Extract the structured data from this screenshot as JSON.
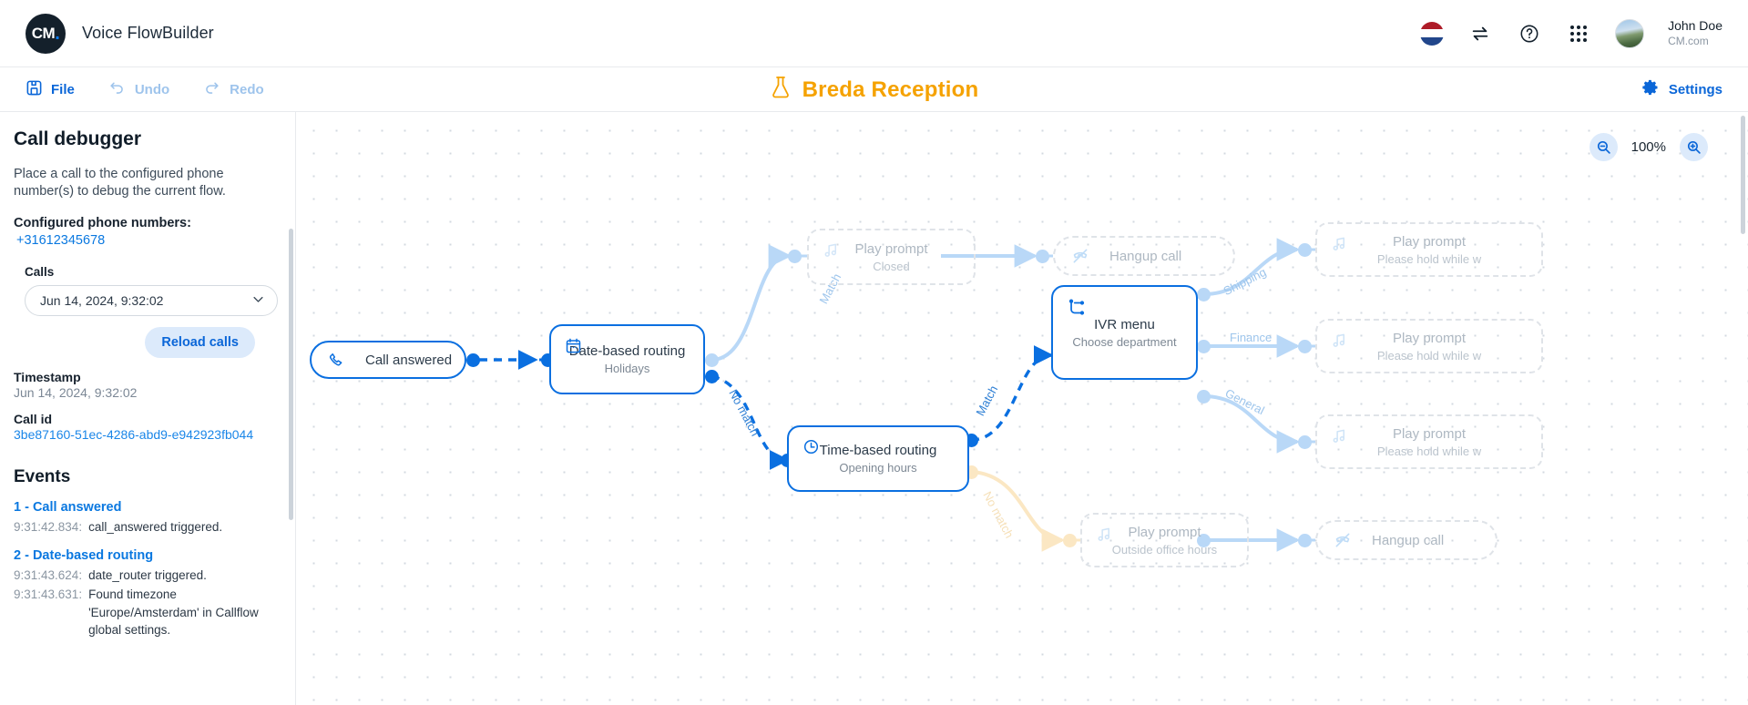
{
  "app": {
    "brand_name": "Voice FlowBuilder",
    "logo_text": "CM",
    "flow_title": "Breda Reception",
    "flow_icon": "flask-icon"
  },
  "topbar": {
    "flag": "netherlands-flag-icon",
    "switch_icon": "switch-arrows-icon",
    "help_icon": "help-circle-icon",
    "apps_icon": "apps-grid-icon",
    "avatar": "user-avatar",
    "user_name": "John Doe",
    "user_org": "CM.com"
  },
  "actionbar": {
    "file": "File",
    "undo": "Undo",
    "redo": "Redo",
    "settings": "Settings"
  },
  "sidebar": {
    "title": "Call debugger",
    "description": "Place a call to the configured phone number(s) to debug the current flow.",
    "configured_label": "Configured phone numbers:",
    "phone_number": "+31612345678",
    "calls_label": "Calls",
    "selected_call": "Jun 14, 2024, 9:32:02",
    "reload_button": "Reload calls",
    "timestamp_label": "Timestamp",
    "timestamp_value": "Jun 14, 2024, 9:32:02",
    "callid_label": "Call id",
    "callid_value": "3be87160-51ec-4286-abd9-e942923fb044",
    "events_heading": "Events",
    "events": [
      {
        "title": "1 - Call answered",
        "lines": [
          {
            "time": "9:31:42.834:",
            "msg": "call_answered triggered."
          }
        ]
      },
      {
        "title": "2 - Date-based routing",
        "lines": [
          {
            "time": "9:31:43.624:",
            "msg": "date_router triggered."
          },
          {
            "time": "9:31:43.631:",
            "msg": "Found timezone 'Europe/Amsterdam' in Callflow global settings."
          }
        ]
      }
    ]
  },
  "canvas": {
    "zoom_level": "100%",
    "zoom_out_icon": "zoom-out-icon",
    "zoom_in_icon": "zoom-in-icon",
    "nodes": [
      {
        "id": "call-answered",
        "title": "Call answered",
        "subtitle": "",
        "icon": "phone-icon",
        "state": "active"
      },
      {
        "id": "date-routing",
        "title": "Date-based routing",
        "subtitle": "Holidays",
        "icon": "calendar-icon",
        "state": "active"
      },
      {
        "id": "prompt-closed",
        "title": "Play prompt",
        "subtitle": "Closed",
        "icon": "music-note-icon",
        "state": "inactive"
      },
      {
        "id": "hangup-top",
        "title": "Hangup call",
        "subtitle": "",
        "icon": "hangup-icon",
        "state": "inactive"
      },
      {
        "id": "time-routing",
        "title": "Time-based routing",
        "subtitle": "Opening hours",
        "icon": "clock-icon",
        "state": "active"
      },
      {
        "id": "ivr-menu",
        "title": "IVR menu",
        "subtitle": "Choose department",
        "icon": "ivr-branch-icon",
        "state": "active"
      },
      {
        "id": "prompt-shipping",
        "title": "Play prompt",
        "subtitle": "Please hold while w",
        "icon": "music-note-icon",
        "state": "inactive"
      },
      {
        "id": "prompt-finance",
        "title": "Play prompt",
        "subtitle": "Please hold while w",
        "icon": "music-note-icon",
        "state": "inactive"
      },
      {
        "id": "prompt-general",
        "title": "Play prompt",
        "subtitle": "Please hold while w",
        "icon": "music-note-icon",
        "state": "inactive"
      },
      {
        "id": "prompt-outside",
        "title": "Play prompt",
        "subtitle": "Outside office hours",
        "icon": "music-note-icon",
        "state": "inactive"
      },
      {
        "id": "hangup-bottom",
        "title": "Hangup call",
        "subtitle": "",
        "icon": "hangup-icon",
        "state": "inactive"
      }
    ],
    "edge_labels": {
      "match_top": "Match",
      "no_match_date": "No match",
      "match_ivr": "Match",
      "no_match_time": "No match",
      "shipping": "Shipping",
      "finance": "Finance",
      "general": "General"
    }
  },
  "colors": {
    "accent_blue": "#0a6fe0",
    "link_blue": "#0a78e0",
    "title_orange": "#f5a200",
    "muted_edge": "#b9d8f7",
    "warm_edge": "#fbe7c3"
  }
}
